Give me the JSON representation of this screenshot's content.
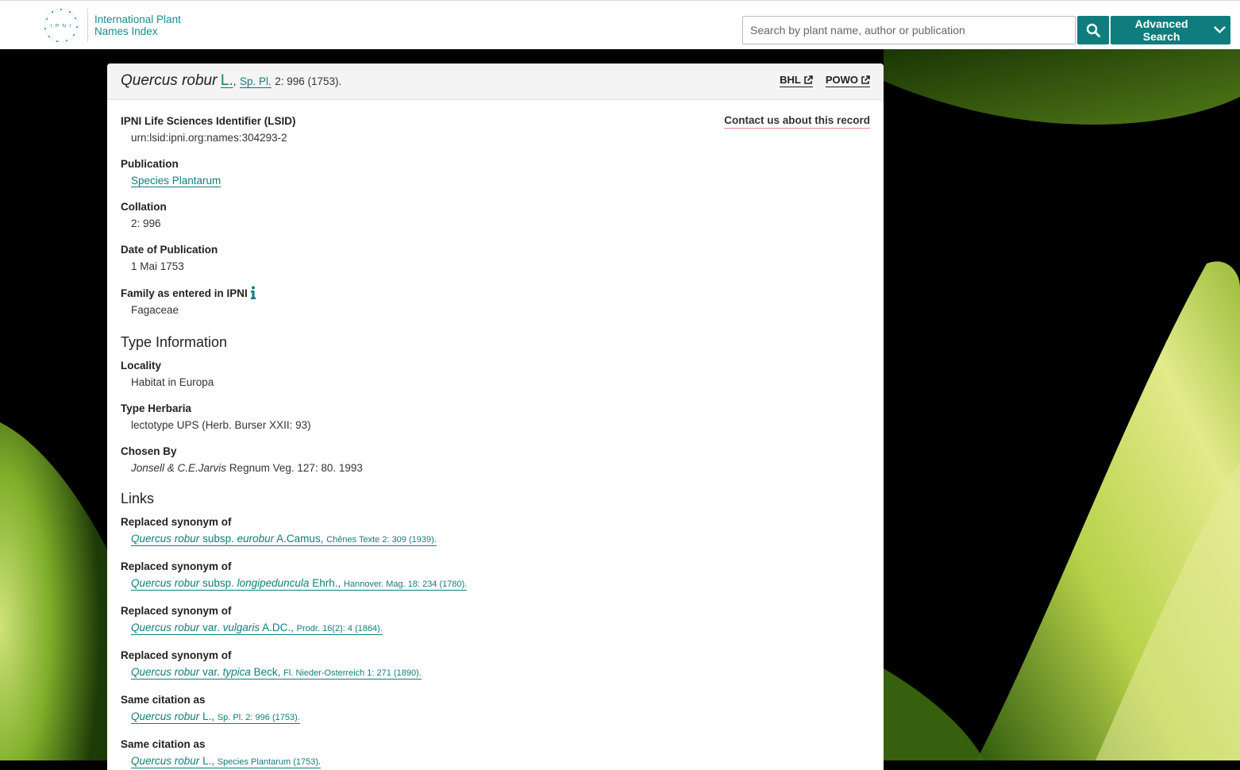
{
  "header": {
    "logo_line1": "International Plant",
    "logo_line2": "Names Index",
    "search_placeholder": "Search by plant name, author or publication",
    "advanced_search_label": "Advanced Search"
  },
  "record": {
    "title": {
      "species": "Quercus robur",
      "author": "L.",
      "comma": ",",
      "publication": "Sp. Pl.",
      "rest": "2: 996 (1753)."
    },
    "ext_links": [
      "BHL",
      "POWO"
    ],
    "contact_label": "Contact us about this record",
    "fields": {
      "lsid_label": "IPNI Life Sciences Identifier (LSID)",
      "lsid_value": "urn:lsid:ipni.org:names:304293-2",
      "publication_label": "Publication",
      "publication_value": "Species Plantarum",
      "collation_label": "Collation",
      "collation_value": "2: 996",
      "date_label": "Date of Publication",
      "date_value": "1 Mai 1753",
      "family_label": "Family as entered in IPNI",
      "family_value": "Fagaceae"
    },
    "type_info": {
      "heading": "Type Information",
      "locality_label": "Locality",
      "locality_value": "Habitat in Europa",
      "herbaria_label": "Type Herbaria",
      "herbaria_value": "lectotype UPS (Herb. Burser XXII: 93)",
      "chosen_label": "Chosen By",
      "chosen_authors": "Jonsell & C.E.Jarvis",
      "chosen_rest": "Regnum Veg. 127: 80. 1993"
    },
    "links": {
      "heading": "Links",
      "items": [
        {
          "label": "Replaced synonym of",
          "name": "Quercus robur",
          "rank": "subsp.",
          "epithet": "eurobur",
          "author": "A.Camus,",
          "citation": "Chênes Texte 2: 309 (1939)."
        },
        {
          "label": "Replaced synonym of",
          "name": "Quercus robur",
          "rank": "subsp.",
          "epithet": "longipeduncula",
          "author": "Ehrh.,",
          "citation": "Hannover. Mag. 18: 234 (1780)."
        },
        {
          "label": "Replaced synonym of",
          "name": "Quercus robur",
          "rank": "var.",
          "epithet": "vulgaris",
          "author": "A.DC.,",
          "citation": "Prodr. 16(2): 4 (1864)."
        },
        {
          "label": "Replaced synonym of",
          "name": "Quercus robur",
          "rank": "var.",
          "epithet": "typica",
          "author": "Beck,",
          "citation": "Fl. Nieder-Osterreich 1: 271 (1890)."
        },
        {
          "label": "Same citation as",
          "name": "Quercus robur",
          "rank": "",
          "epithet": "",
          "author": "L.,",
          "citation": "Sp. Pl. 2: 996 (1753)."
        },
        {
          "label": "Same citation as",
          "name": "Quercus robur",
          "rank": "",
          "epithet": "",
          "author": "L.,",
          "citation": "Species Plantarum (1753)."
        }
      ]
    }
  }
}
